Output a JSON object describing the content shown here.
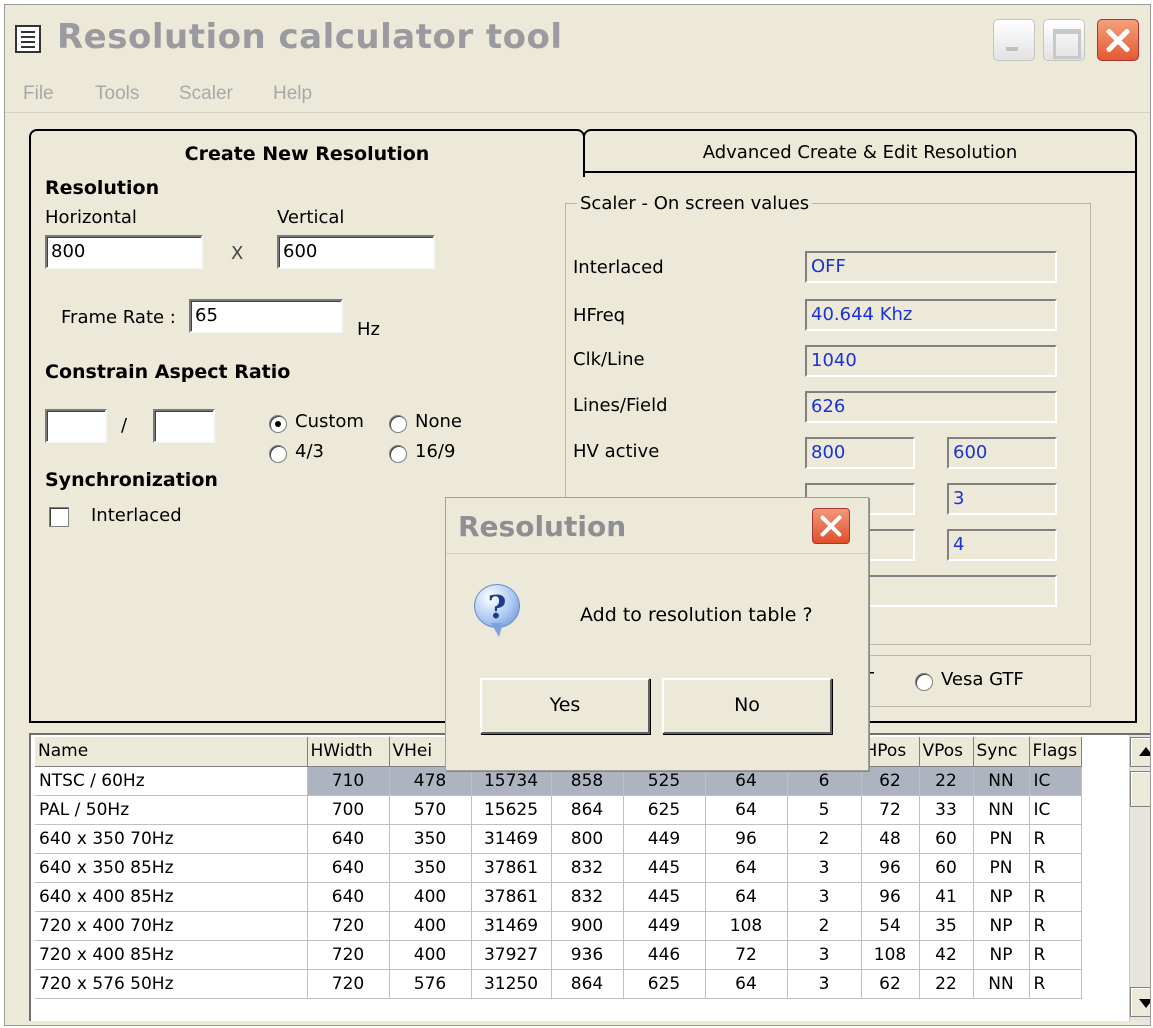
{
  "window": {
    "title": "Resolution calculator tool"
  },
  "menu": {
    "items": [
      "File",
      "Tools",
      "Scaler",
      "Help"
    ]
  },
  "tabs": [
    {
      "label": "Create New Resolution",
      "active": true
    },
    {
      "label": "Advanced Create & Edit Resolution",
      "active": false
    }
  ],
  "create": {
    "resolution_heading": "Resolution",
    "horizontal_label": "Horizontal",
    "vertical_label": "Vertical",
    "horizontal_value": "800",
    "vertical_value": "600",
    "times_symbol": "X",
    "frame_rate_label": "Frame Rate :",
    "frame_rate_value": "65",
    "frame_rate_unit": "Hz",
    "aspect_heading": "Constrain Aspect Ratio",
    "aspect_num": "",
    "aspect_den": "",
    "aspect_sep": "/",
    "aspect_options": {
      "custom": "Custom",
      "none": "None",
      "four_three": "4/3",
      "sixteen_nine": "16/9"
    },
    "aspect_selected": "Custom",
    "sync_heading": "Synchronization",
    "interlaced_label": "Interlaced",
    "interlaced_checked": false
  },
  "scaler": {
    "legend": "Scaler - On screen values",
    "interlaced_label": "Interlaced",
    "interlaced_value": "OFF",
    "hfreq_label": "HFreq",
    "hfreq_value": "40.644 Khz",
    "clkline_label": "Clk/Line",
    "clkline_value": "1040",
    "linesfield_label": "Lines/Field",
    "linesfield_value": "626",
    "hvactive_label": "HV active",
    "hvactive_h": "800",
    "hvactive_v": "600",
    "row6_h": "",
    "row6_v": "3",
    "row7_h": "",
    "row7_v": "4",
    "row8_value": ""
  },
  "method": {
    "cvt_partial": "T",
    "gtf_label": "Vesa GTF",
    "selected": "cvt"
  },
  "table": {
    "columns": [
      "Name",
      "HWidth",
      "VHei",
      "",
      "",
      "",
      "",
      "",
      "HPos",
      "VPos",
      "Sync",
      "Flags"
    ],
    "rows": [
      [
        "NTSC / 60Hz",
        "710",
        "478",
        "15734",
        "858",
        "525",
        "64",
        "6",
        "62",
        "22",
        "NN",
        "IC"
      ],
      [
        "PAL / 50Hz",
        "700",
        "570",
        "15625",
        "864",
        "625",
        "64",
        "5",
        "72",
        "33",
        "NN",
        "IC"
      ],
      [
        "640 x 350 70Hz",
        "640",
        "350",
        "31469",
        "800",
        "449",
        "96",
        "2",
        "48",
        "60",
        "PN",
        "R"
      ],
      [
        "640 x 350 85Hz",
        "640",
        "350",
        "37861",
        "832",
        "445",
        "64",
        "3",
        "96",
        "60",
        "PN",
        "R"
      ],
      [
        "640 x 400 85Hz",
        "640",
        "400",
        "37861",
        "832",
        "445",
        "64",
        "3",
        "96",
        "41",
        "NP",
        "R"
      ],
      [
        "720 x 400 70Hz",
        "720",
        "400",
        "31469",
        "900",
        "449",
        "108",
        "2",
        "54",
        "35",
        "NP",
        "R"
      ],
      [
        "720 x 400 85Hz",
        "720",
        "400",
        "37927",
        "936",
        "446",
        "72",
        "3",
        "108",
        "42",
        "NP",
        "R"
      ],
      [
        "720 x 576 50Hz",
        "720",
        "576",
        "31250",
        "864",
        "625",
        "64",
        "3",
        "62",
        "22",
        "NN",
        "R"
      ]
    ],
    "selected_row": 0
  },
  "dialog": {
    "title": "Resolution",
    "message": "Add to resolution table ?",
    "yes_label": "Yes",
    "no_label": "No"
  },
  "icons": {
    "app": "calculator-icon",
    "minimize": "minimize-icon",
    "maximize": "maximize-icon",
    "close": "close-icon",
    "question": "question-icon",
    "scroll_up": "arrow-up-icon",
    "scroll_down": "arrow-down-icon"
  },
  "colors": {
    "window_bg": "#ece9d8",
    "readonly_value": "#1a32d8",
    "close_button": "#e25a31",
    "selected_row": "#aeb4bf"
  }
}
